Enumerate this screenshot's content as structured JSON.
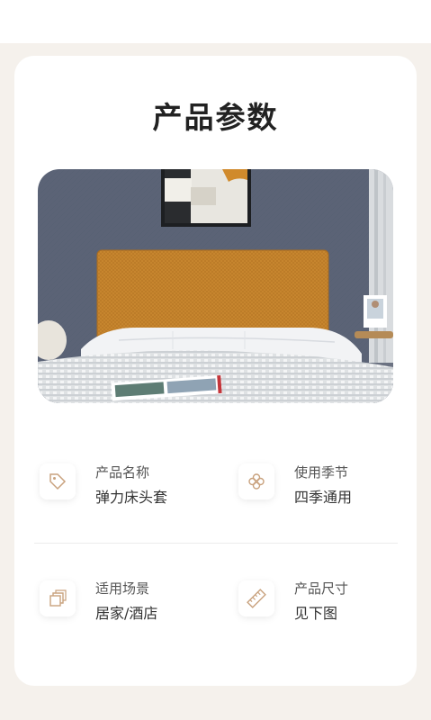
{
  "page": {
    "title": "产品参数"
  },
  "photo": {
    "subject": "bed with mustard elastic headboard cover"
  },
  "specs": [
    {
      "label": "产品名称",
      "value": "弹力床头套",
      "icon": "tag-icon"
    },
    {
      "label": "使用季节",
      "value": "四季通用",
      "icon": "flower-icon"
    },
    {
      "label": "适用场景",
      "value": "居家/酒店",
      "icon": "layers-icon"
    },
    {
      "label": "产品尺寸",
      "value": "见下图",
      "icon": "ruler-icon"
    }
  ],
  "colors": {
    "accent": "#c9a27e",
    "background": "#f5f1ec",
    "card": "#ffffff"
  }
}
